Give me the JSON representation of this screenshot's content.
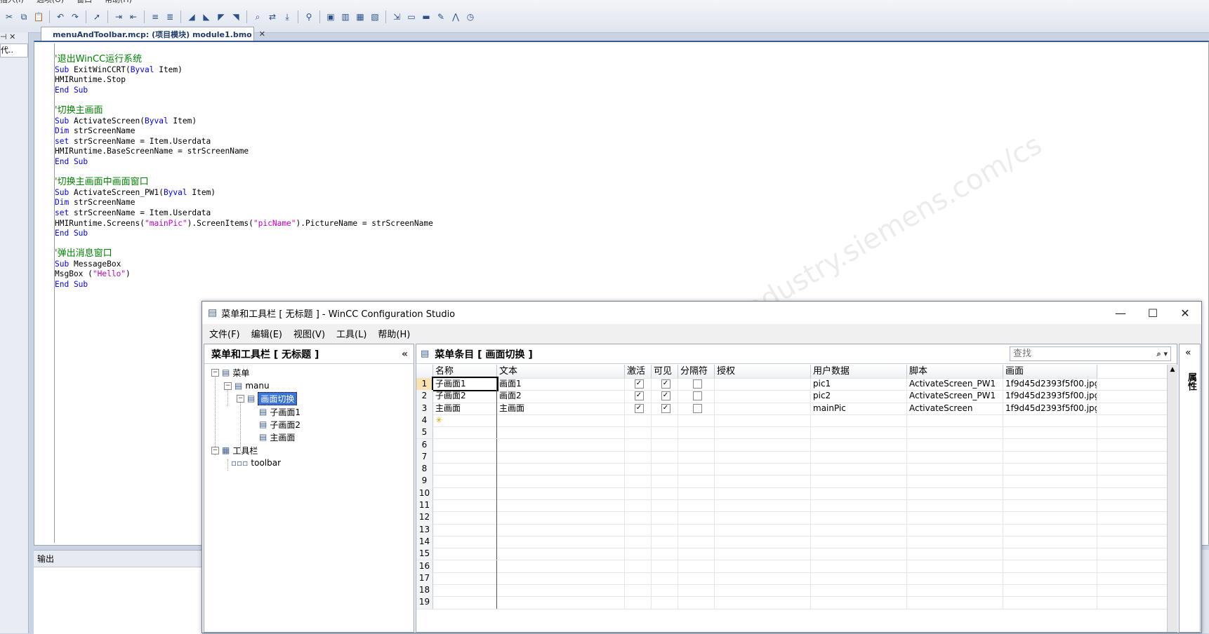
{
  "ide": {
    "menu_remnant": [
      "插入(I)",
      "选项(O)",
      "窗口",
      "帮助(H)"
    ],
    "left_dock": {
      "pin": "⊣ ✕",
      "tab": "代.."
    },
    "doc_tab": {
      "title": "menuAndToolbar.mcp: (项目模块) module1.bmo",
      "close": "✕"
    },
    "output": {
      "title": "输出"
    },
    "watermark": "西门子工业 技术论坛 industry.siemens.com/cs"
  },
  "code": [
    [
      {
        "t": "'退出WinCC运行系统",
        "c": "c-comment"
      }
    ],
    [
      {
        "t": "Sub",
        "c": "c-kw"
      },
      {
        "t": " ExitWinCCRT("
      },
      {
        "t": "Byval",
        "c": "c-kw"
      },
      {
        "t": " Item)"
      }
    ],
    [
      {
        "t": "HMIRuntime.Stop"
      }
    ],
    [
      {
        "t": "End Sub",
        "c": "c-kw"
      }
    ],
    [
      {
        "t": ""
      }
    ],
    [
      {
        "t": "'切换主画面",
        "c": "c-comment"
      }
    ],
    [
      {
        "t": "Sub",
        "c": "c-kw"
      },
      {
        "t": " ActivateScreen("
      },
      {
        "t": "Byval",
        "c": "c-kw"
      },
      {
        "t": " Item)"
      }
    ],
    [
      {
        "t": "Dim",
        "c": "c-kw"
      },
      {
        "t": " strScreenName"
      }
    ],
    [
      {
        "t": "set",
        "c": "c-kw"
      },
      {
        "t": " strScreenName = Item.Userdata"
      }
    ],
    [
      {
        "t": "HMIRuntime.BaseScreenName = strScreenName"
      }
    ],
    [
      {
        "t": "End Sub",
        "c": "c-kw"
      }
    ],
    [
      {
        "t": ""
      }
    ],
    [
      {
        "t": "'切换主画面中画面窗口",
        "c": "c-comment"
      }
    ],
    [
      {
        "t": "Sub",
        "c": "c-kw"
      },
      {
        "t": " ActivateScreen_PW1("
      },
      {
        "t": "Byval",
        "c": "c-kw"
      },
      {
        "t": " Item)"
      }
    ],
    [
      {
        "t": "Dim",
        "c": "c-kw"
      },
      {
        "t": " strScreenName"
      }
    ],
    [
      {
        "t": "set",
        "c": "c-kw"
      },
      {
        "t": " strScreenName = Item.Userdata"
      }
    ],
    [
      {
        "t": "HMIRuntime.Screens("
      },
      {
        "t": "\"mainPic\"",
        "c": "c-str"
      },
      {
        "t": ").ScreenItems("
      },
      {
        "t": "\"picName\"",
        "c": "c-str"
      },
      {
        "t": ").PictureName = strScreenName"
      }
    ],
    [
      {
        "t": "End Sub",
        "c": "c-kw"
      }
    ],
    [
      {
        "t": ""
      }
    ],
    [
      {
        "t": "'弹出消息窗口",
        "c": "c-comment"
      }
    ],
    [
      {
        "t": "Sub",
        "c": "c-kw"
      },
      {
        "t": " MessageBox"
      }
    ],
    [
      {
        "t": "MsgBox ("
      },
      {
        "t": "\"Hello\"",
        "c": "c-str"
      },
      {
        "t": ")"
      }
    ],
    [
      {
        "t": "End Sub",
        "c": "c-kw"
      }
    ]
  ],
  "dialog": {
    "title": "菜单和工具栏 [ 无标题 ] - WinCC Configuration Studio",
    "controls": {
      "minimize": "—",
      "maximize": "☐",
      "close": "✕"
    },
    "menu": [
      "文件(F)",
      "编辑(E)",
      "视图(V)",
      "工具(L)",
      "帮助(H)"
    ],
    "tree": {
      "header": "菜单和工具栏 [ 无标题 ]",
      "collapse": "«",
      "nodes": [
        "菜单",
        "manu",
        "画面切换",
        "子画面1",
        "子画面2",
        "主画面",
        "工具栏",
        "toolbar"
      ]
    },
    "grid": {
      "header": "菜单条目 [ 画面切换 ]",
      "search_placeholder": "查找",
      "search_icon": "⌕ ▾",
      "columns": [
        "名称",
        "文本",
        "激活",
        "可见",
        "分隔符",
        "授权",
        "用户数据",
        "脚本",
        "画面"
      ],
      "rows": [
        {
          "num": "1",
          "name": "子画面1",
          "text": "画面1",
          "active": true,
          "visible": true,
          "separator": false,
          "auth": "",
          "userdata": "pic1",
          "script": "ActivateScreen_PW1",
          "picture": "1f9d45d2393f5f00.jpg"
        },
        {
          "num": "2",
          "name": "子画面2",
          "text": "画面2",
          "active": true,
          "visible": true,
          "separator": false,
          "auth": "",
          "userdata": "pic2",
          "script": "ActivateScreen_PW1",
          "picture": "1f9d45d2393f5f00.jpg"
        },
        {
          "num": "3",
          "name": "主画面",
          "text": "主画面",
          "active": true,
          "visible": true,
          "separator": false,
          "auth": "",
          "userdata": "mainPic",
          "script": "ActivateScreen",
          "picture": "1f9d45d2393f5f00.jpg"
        }
      ],
      "empty_row_numbers": [
        "4",
        "5",
        "6",
        "7",
        "8",
        "9",
        "10",
        "11",
        "12",
        "13",
        "14",
        "15",
        "16",
        "17",
        "18",
        "19"
      ],
      "new_row_marker": "✳"
    },
    "properties": {
      "collapse": "«",
      "label": "属性"
    }
  }
}
